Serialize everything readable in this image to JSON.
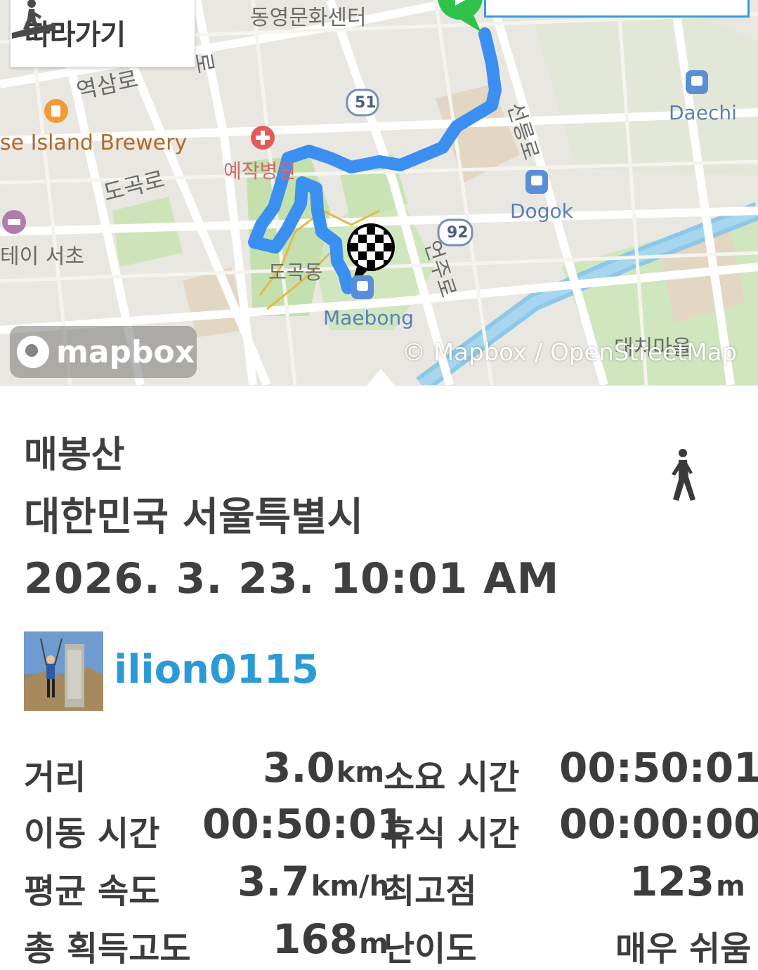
{
  "map": {
    "follow_button_label": "따라가기",
    "labels": {
      "dongyeong": "동영문화센터",
      "yeoksam": "역삼로",
      "brewery": "se Island Brewery",
      "dogok_ro": "도곡로",
      "yechak": "예작병원",
      "stay": "테이 서초",
      "dogok_dong": "도곡동",
      "maebong": "Maebong",
      "eonju": "언주로",
      "seolleung": "선릉로",
      "dogok": "Dogok",
      "daechi": "Daechi",
      "daechi_village": "대치마을",
      "road51": "51",
      "road92": "92",
      "ro_vertical": "로"
    },
    "logo_text": "mapbox",
    "attribution": "© Mapbox / OpenStreetMap",
    "colors": {
      "route": "#3b8ff0",
      "park": "#b9dca2",
      "water": "#8dc8e8",
      "road": "#ffffff"
    }
  },
  "activity": {
    "title": "매봉산",
    "region": "대한민국 서울특별시",
    "datetime": "2026. 3. 23. 10:01 AM",
    "activity_icon": "walking-person-icon",
    "username": "ilion0115",
    "avatar_icon": "hiker-photo"
  },
  "stats": {
    "distance_label": "거리",
    "distance_value": "3.0",
    "distance_unit": "km",
    "duration_label": "소요 시간",
    "duration_value": "00:50:01",
    "moving_label": "이동 시간",
    "moving_value": "00:50:01",
    "rest_label": "휴식 시간",
    "rest_value": "00:00:00",
    "speed_label": "평균 속도",
    "speed_value": "3.7",
    "speed_unit": "km/h",
    "peak_label": "최고점",
    "peak_value": "123",
    "peak_unit": "m",
    "gain_label": "총 획득고도",
    "gain_value": "168",
    "gain_unit": "m",
    "difficulty_label": "난이도",
    "difficulty_value": "매우 쉬움"
  }
}
